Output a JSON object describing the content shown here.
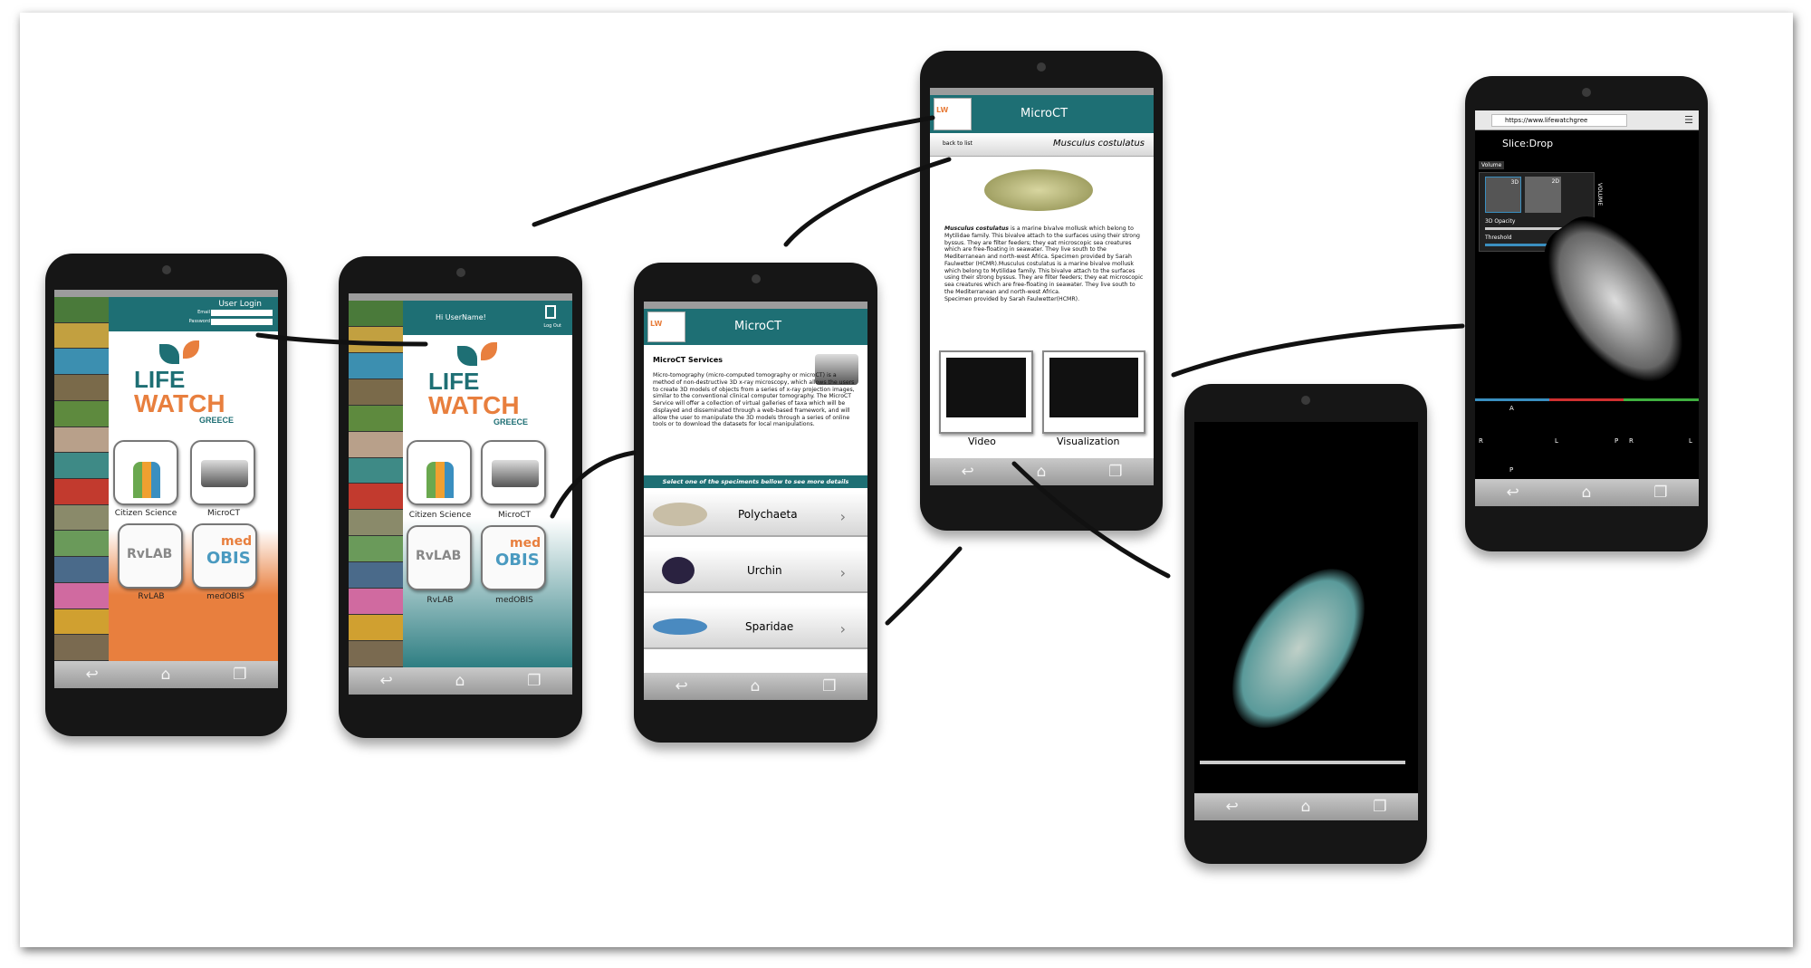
{
  "p1": {
    "login_title": "User Login",
    "email_label": "Email",
    "password_label": "Password",
    "logo_line1": "LIFE",
    "logo_line2": "WATCH",
    "logo_line3": "GREECE",
    "apps": [
      "Citizen Science",
      "MicroCT",
      "RvLAB",
      "medOBIS"
    ],
    "rv_logo": "RvLAB",
    "med_logo_1": "med",
    "med_logo_2": "OBIS"
  },
  "p2": {
    "greeting": "Hi UserName!",
    "logout": "Log Out",
    "logo_line1": "LIFE",
    "logo_line2": "WATCH",
    "logo_line3": "GREECE",
    "apps": [
      "Citizen Science",
      "MicroCT",
      "RvLAB",
      "medOBIS"
    ]
  },
  "p3": {
    "title": "MicroCT",
    "section": "MicroCT Services",
    "body": "Micro-tomography (micro-computed tomography or microCT) is a method of non-destructive 3D x-ray microscopy, which allows the users to create 3D models of objects from a series of x-ray projection images, similar to the conventional clinical computer tomography. The MicroCT Service will offer a collection of virtual galleries of taxa which will be displayed and disseminated through a web-based framework, and will allow the user to manipulate the 3D models through a series of online tools or to download the datasets for local manipulations.",
    "select": "Select one of the speciments bellow  to see more details",
    "items": [
      "Polychaeta",
      "Urchin",
      "Sparidae"
    ]
  },
  "p4": {
    "title": "MicroCT",
    "back": "back to list",
    "species": "Musculus costulatus",
    "desc_bold": "Musculus costulatus",
    "desc": " is a marine bivalve mollusk which belong to Mytilidae family. This bivalve attach to the surfaces using their strong byssus. They are filter feeders; they eat microscopic sea creatures which are free-floating in seawater. They live south to the Mediterranean and north-west Africa. Specimen provided by Sarah Faulwetter (HCMR).Musculus costulatus is a marine bivalve mollusk which belong to Mytilidae family. This bivalve attach to the surfaces using their strong byssus. They are filter feeders; they eat microscopic sea creatures which are free-floating in seawater. They live south to the Mediterranean and north-west Africa.",
    "desc_end": "Specimen provided by Sarah Faulwetter(HCMR).",
    "btn_video": "Video",
    "btn_vis": "Visualization"
  },
  "p6": {
    "url": "https://www.lifewatchgree",
    "app": "Slice:Drop",
    "volume": "Volume",
    "opacity": "3D Opacity",
    "threshold": "Threshold",
    "tab_3d": "3D",
    "tab_2d": "2D",
    "side": "VOLUME",
    "letters": [
      "A",
      "R",
      "P",
      "L",
      "P",
      "R",
      "L"
    ]
  },
  "nav": {
    "back": "↩",
    "home": "⌂",
    "recent": "❐"
  },
  "colors": {
    "teal": "#1e6f74",
    "orange": "#e87f3e",
    "green": "#6aa84f"
  }
}
